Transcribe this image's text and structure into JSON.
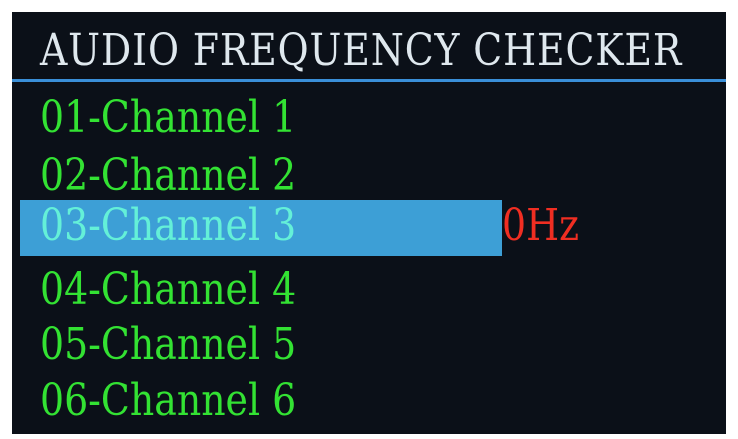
{
  "screen": {
    "title": "AUDIO FREQUENCY CHECKER",
    "channels": [
      {
        "label": "01-Channel 1"
      },
      {
        "label": "02-Channel 2"
      },
      {
        "label": "03-Channel 3"
      },
      {
        "label": "04-Channel 4"
      },
      {
        "label": "05-Channel 5"
      },
      {
        "label": "06-Channel 6"
      }
    ],
    "selected_index": 2,
    "selected_frequency": "0Hz"
  },
  "colors": {
    "background": "#0b1018",
    "title_text": "#dfe8ee",
    "title_rule": "#3a8fd8",
    "item_text": "#33e233",
    "selected_bar": "#3d9fd6",
    "selected_text": "#64f0d8",
    "frequency_text": "#f02e22"
  }
}
